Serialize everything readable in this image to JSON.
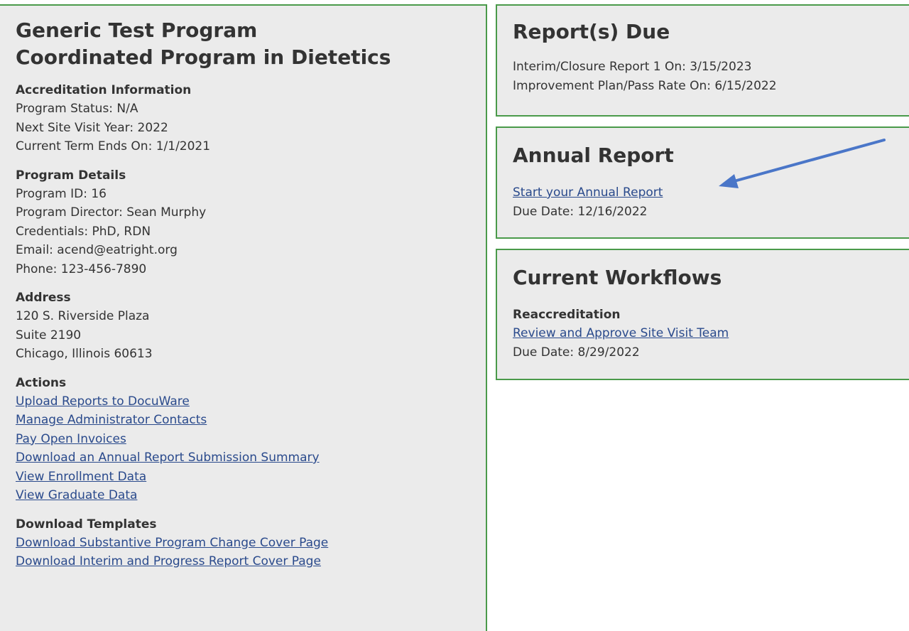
{
  "program": {
    "name": "Generic Test Program",
    "type": "Coordinated Program in Dietetics"
  },
  "accreditation": {
    "heading": "Accreditation Information",
    "status": "Program Status: N/A",
    "next_site_visit": "Next Site Visit Year: 2022",
    "term_ends": "Current Term Ends On: 1/1/2021"
  },
  "details": {
    "heading": "Program Details",
    "program_id": "Program ID: 16",
    "director": "Program Director: Sean Murphy",
    "credentials": "Credentials: PhD, RDN",
    "email": "Email: acend@eatright.org",
    "phone": "Phone: 123-456-7890"
  },
  "address": {
    "heading": "Address",
    "line1": "120 S. Riverside Plaza",
    "line2": "Suite 2190",
    "line3": "Chicago, Illinois 60613"
  },
  "actions": {
    "heading": "Actions",
    "links": [
      "Upload Reports to DocuWare",
      "Manage Administrator Contacts",
      "Pay Open Invoices",
      "Download an Annual Report Submission Summary",
      "View Enrollment Data",
      "View Graduate Data"
    ]
  },
  "templates": {
    "heading": "Download Templates",
    "links": [
      "Download Substantive Program Change Cover Page",
      "Download Interim and Progress Report Cover Page"
    ]
  },
  "reports_due": {
    "title": "Report(s) Due",
    "items": [
      "Interim/Closure Report 1 On: 3/15/2023",
      "Improvement Plan/Pass Rate On: 6/15/2022"
    ]
  },
  "annual_report": {
    "title": "Annual Report",
    "link": "Start your Annual Report",
    "due_date": "Due Date: 12/16/2022"
  },
  "workflows": {
    "title": "Current Workflows",
    "workflow_name": "Reaccreditation",
    "link": "Review and Approve Site Visit Team",
    "due_date": "Due Date: 8/29/2022"
  },
  "colors": {
    "panel_background": "#ebebeb",
    "panel_border": "#4a9a4a",
    "link": "#2a4a8c",
    "text": "#333333",
    "arrow": "#4a76c8"
  },
  "annotation": {
    "icon": "arrow-icon"
  }
}
